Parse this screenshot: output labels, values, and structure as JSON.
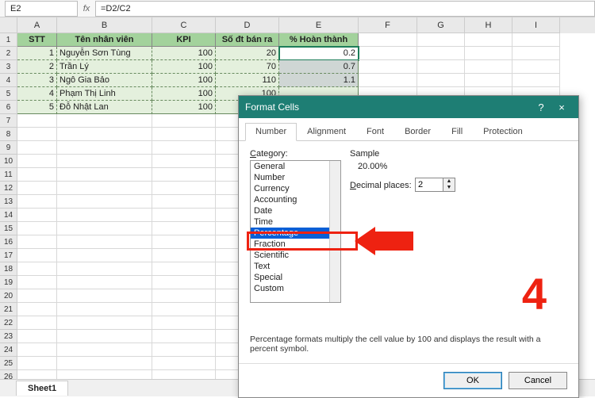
{
  "formula_bar": {
    "name_box": "E2",
    "fx": "fx",
    "formula": "=D2/C2"
  },
  "columns": [
    "A",
    "B",
    "C",
    "D",
    "E",
    "F",
    "G",
    "H",
    "I"
  ],
  "headers": {
    "A": "STT",
    "B": "Tên nhân viên",
    "C": "KPI",
    "D": "Số đt bán ra",
    "E": "% Hoàn thành"
  },
  "rows": [
    {
      "n": 1,
      "A": "1",
      "B": "Nguyễn Sơn Tùng",
      "C": "100",
      "D": "20",
      "E": "0.2"
    },
    {
      "n": 2,
      "A": "2",
      "B": "Trần Lý",
      "C": "100",
      "D": "70",
      "E": "0.7"
    },
    {
      "n": 3,
      "A": "3",
      "B": "Ngô Gia Bảo",
      "C": "100",
      "D": "110",
      "E": "1.1"
    },
    {
      "n": 4,
      "A": "4",
      "B": "Phạm Thị Linh",
      "C": "100",
      "D": "100",
      "E": ""
    },
    {
      "n": 5,
      "A": "5",
      "B": "Đỗ Nhật Lan",
      "C": "100",
      "D": "",
      "E": ""
    }
  ],
  "empty_rows": [
    7,
    8,
    9,
    10,
    11,
    12,
    13,
    14,
    15,
    16,
    17,
    18,
    19,
    20,
    21,
    22,
    23,
    24,
    25,
    26
  ],
  "sheet_tab": "Sheet1",
  "dialog": {
    "title": "Format Cells",
    "help": "?",
    "close": "×",
    "tabs": [
      "Number",
      "Alignment",
      "Font",
      "Border",
      "Fill",
      "Protection"
    ],
    "active_tab": "Number",
    "category_label": "Category:",
    "categories": [
      "General",
      "Number",
      "Currency",
      "Accounting",
      "Date",
      "Time",
      "Percentage",
      "Fraction",
      "Scientific",
      "Text",
      "Special",
      "Custom"
    ],
    "selected_category": "Percentage",
    "sample_label": "Sample",
    "sample_value": "20.00%",
    "decimal_label": "Decimal places:",
    "decimal_value": "2",
    "description": "Percentage formats multiply the cell value by 100 and displays the result with a percent symbol.",
    "ok": "OK",
    "cancel": "Cancel"
  },
  "annotation": "4"
}
